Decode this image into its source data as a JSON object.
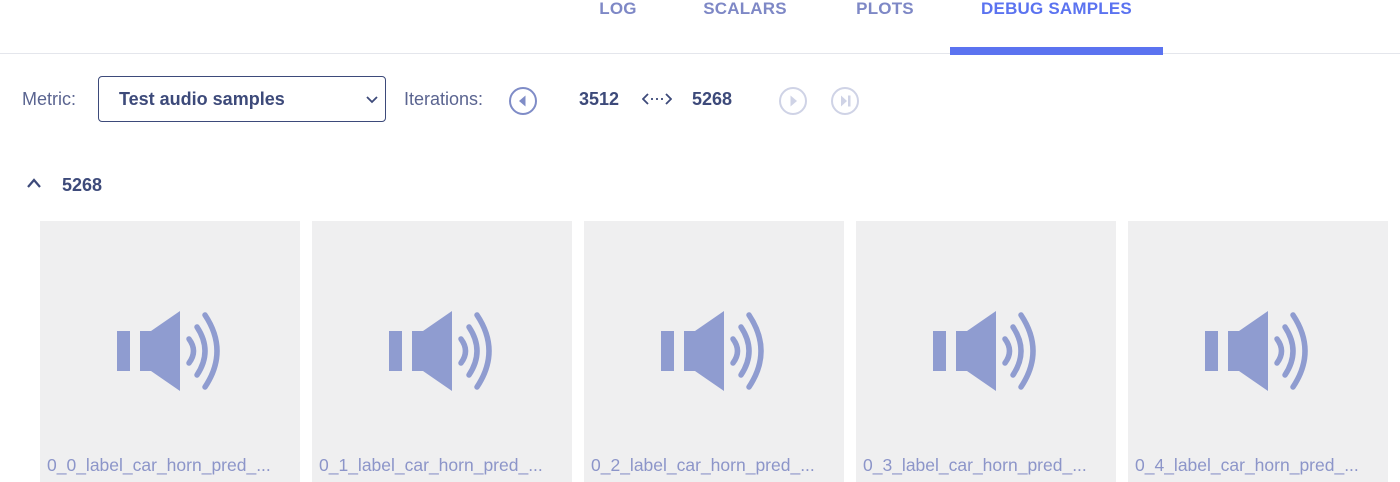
{
  "tabs": [
    {
      "label": "LOG",
      "active": false
    },
    {
      "label": "SCALARS",
      "active": false
    },
    {
      "label": "PLOTS",
      "active": false
    },
    {
      "label": "DEBUG SAMPLES",
      "active": true
    }
  ],
  "controls": {
    "metric_label": "Metric:",
    "metric_value": "Test audio samples",
    "iterations_label": "Iterations:",
    "iteration_start": "3512",
    "iteration_end": "5268",
    "range_arrow": "<-->",
    "buttons": [
      "previous-icon",
      "next-icon",
      "last-icon"
    ]
  },
  "group": {
    "iteration": "5268",
    "expanded": true
  },
  "samples": [
    {
      "name": "0_0_label_car_horn_pred_...",
      "icon": "speaker-icon"
    },
    {
      "name": "0_1_label_car_horn_pred_...",
      "icon": "speaker-icon"
    },
    {
      "name": "0_2_label_car_horn_pred_...",
      "icon": "speaker-icon"
    },
    {
      "name": "0_3_label_car_horn_pred_...",
      "icon": "speaker-icon"
    },
    {
      "name": "0_4_label_car_horn_pred_...",
      "icon": "speaker-icon"
    }
  ],
  "colors": {
    "accent": "#5b73f0",
    "tab_text": "#7e88c6",
    "dark_text": "#3d4a7a",
    "icon": "#8f9cd0",
    "tile_bg": "#efeff0"
  }
}
